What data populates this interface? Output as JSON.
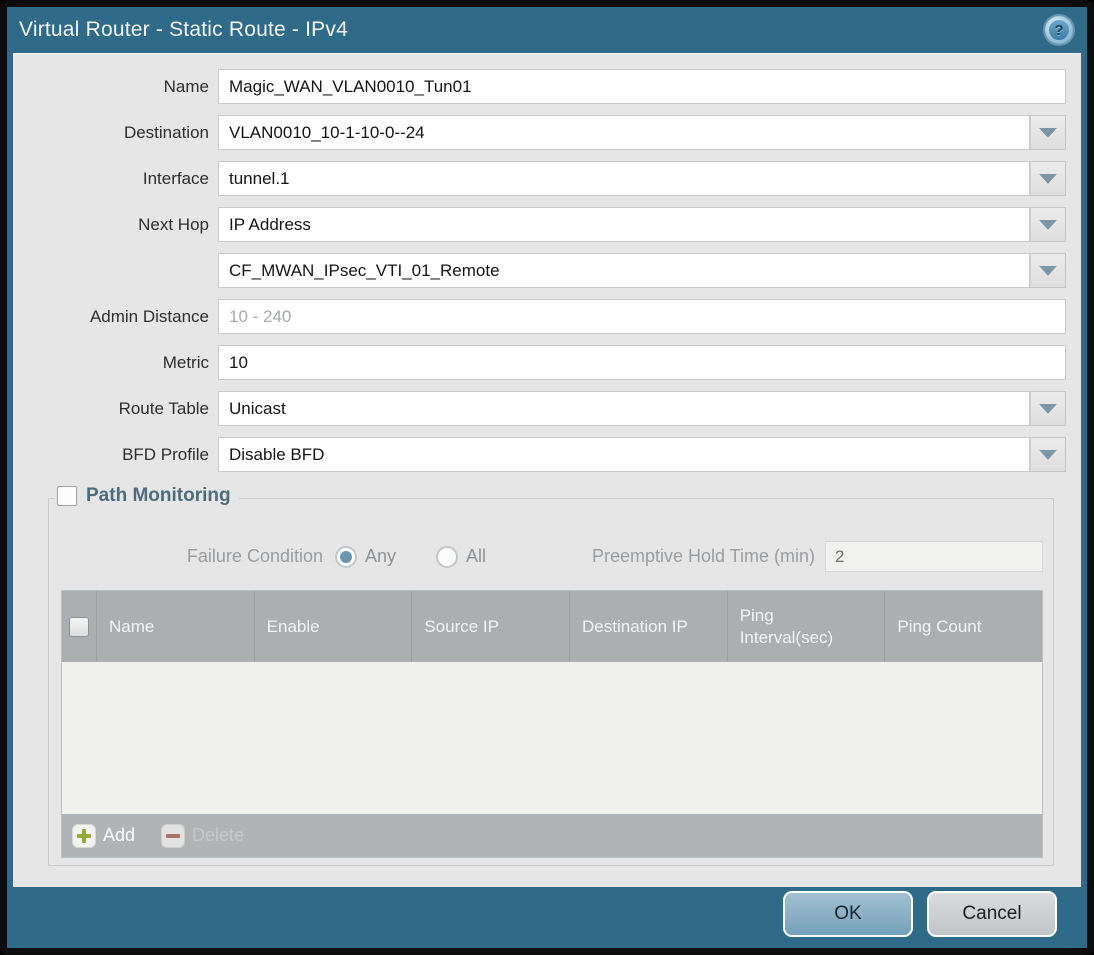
{
  "window": {
    "title": "Virtual Router - Static Route - IPv4"
  },
  "colors": {
    "titlebar_teal": "#2f6b89",
    "content_gray": "#e6e6e6",
    "table_header_gray": "#abafb2",
    "ok_button_blue": "#7ba7c0",
    "add_icon_green": "#94a93c",
    "delete_icon_red": "#a95f52"
  },
  "form": {
    "rows": [
      {
        "label": "Name",
        "value": "Magic_WAN_VLAN0010_Tun01",
        "type": "text"
      },
      {
        "label": "Destination",
        "value": "VLAN0010_10-1-10-0--24",
        "type": "dropdown"
      },
      {
        "label": "Interface",
        "value": "tunnel.1",
        "type": "dropdown"
      },
      {
        "label": "Next Hop",
        "value": "IP Address",
        "type": "dropdown"
      },
      {
        "label": "",
        "value": "CF_MWAN_IPsec_VTI_01_Remote",
        "type": "dropdown"
      },
      {
        "label": "Admin Distance",
        "value": "",
        "placeholder": "10 - 240",
        "type": "text"
      },
      {
        "label": "Metric",
        "value": "10",
        "type": "text"
      },
      {
        "label": "Route Table",
        "value": "Unicast",
        "type": "dropdown"
      },
      {
        "label": "BFD Profile",
        "value": "Disable BFD",
        "type": "dropdown"
      }
    ]
  },
  "path_monitoring": {
    "title": "Path Monitoring",
    "checkbox_checked": false,
    "failure_condition": {
      "label": "Failure Condition",
      "options": [
        "Any",
        "All"
      ],
      "selected": "Any"
    },
    "preemptive_hold_time": {
      "label": "Preemptive Hold Time (min)",
      "value": "2"
    },
    "table": {
      "headers": [
        "Name",
        "Enable",
        "Source IP",
        "Destination IP",
        "Ping Interval(sec)",
        "Ping Count"
      ],
      "rows": []
    },
    "toolbar": {
      "add_label": "Add",
      "delete_label": "Delete"
    }
  },
  "footer": {
    "ok_label": "OK",
    "cancel_label": "Cancel"
  }
}
